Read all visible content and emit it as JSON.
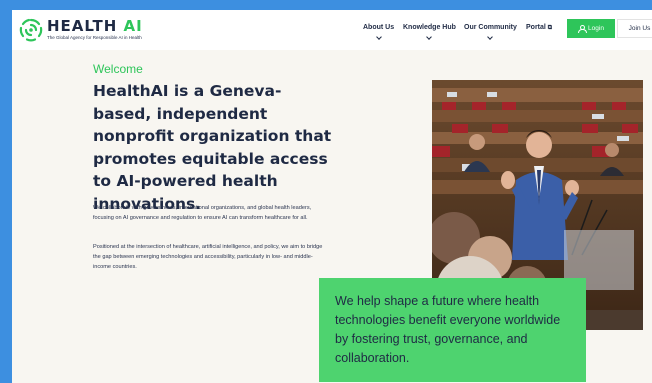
{
  "header": {
    "brand_main": "HEALTH",
    "brand_accent": "AI",
    "tagline": "The Global Agency for Responsible AI in Health",
    "nav": [
      {
        "label": "About Us"
      },
      {
        "label": "Knowledge Hub"
      },
      {
        "label": "Our Community"
      }
    ],
    "portal_label": "Portal",
    "portal_icon": "external-link-icon",
    "login_label": "Login",
    "join_label": "Join Us"
  },
  "hero": {
    "eyebrow": "Welcome",
    "headline": "HealthAI is a Geneva-based, independent nonprofit organization that promotes equitable access to AI-powered health innovations.",
    "paragraph_1": "We collaborate with governments, international organizations, and global health leaders, focusing on AI governance and regulation to ensure AI can transform healthcare for all.",
    "paragraph_2": "Positioned at the intersection of healthcare, artificial intelligence, and policy, we aim to bridge the gap between emerging technologies and accessibility, particularly in low- and middle-income countries."
  },
  "card": {
    "text": "We help shape a future where health technologies benefit everyone worldwide by fostering trust, governance, and collaboration."
  },
  "colors": {
    "accent": "#2ec55a",
    "card": "#4ed36f",
    "text": "#1f2a44",
    "background": "#f8f6f1",
    "outer": "#3d8fe0"
  }
}
